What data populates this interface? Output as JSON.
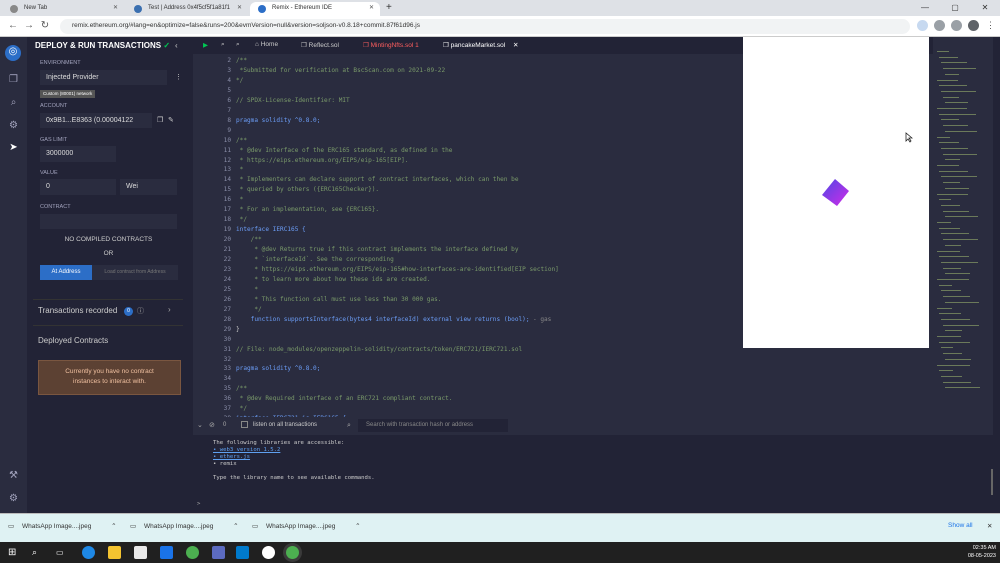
{
  "browser": {
    "tabs": [
      {
        "title": "New Tab"
      },
      {
        "title": "Test | Address 0x4f5cf5f1a81f1"
      },
      {
        "title": "Remix - Ethereum IDE"
      }
    ],
    "new_tab": "+",
    "window_buttons": [
      "—",
      "▢",
      "✕"
    ],
    "url": "remix.ethereum.org/#lang=en&optimize=false&runs=200&evmVersion=null&version=soljson-v0.8.18+commit.87f61d96.js"
  },
  "sidebar": {
    "title": "DEPLOY & RUN TRANSACTIONS",
    "environment_label": "ENVIRONMENT",
    "environment_value": "Injected Provider",
    "network_badge": "Custom (80001) network",
    "account_label": "ACCOUNT",
    "account_value": "0x9B1...E8363 (0.00004122",
    "gas_limit_label": "GAS LIMIT",
    "gas_limit_value": "3000000",
    "value_label": "VALUE",
    "value_amount": "0",
    "value_unit": "Wei",
    "contract_label": "CONTRACT",
    "no_contracts": "NO COMPILED CONTRACTS",
    "or": "OR",
    "at_address": "At Address",
    "load_contract": "Load contract from Address",
    "transactions_recorded": "Transactions recorded",
    "transactions_count": "0",
    "deployed_contracts": "Deployed Contracts",
    "no_instances": "Currently you have no contract instances to interact with."
  },
  "editor": {
    "tabs": [
      {
        "label": "Home"
      },
      {
        "label": "Reflect.sol"
      },
      {
        "label": "MintingNfts.sol",
        "badge": "1"
      },
      {
        "label": "pancakeMarket.sol"
      }
    ],
    "lines": [
      {
        "n": "2",
        "t": "/**"
      },
      {
        "n": "3",
        "t": " *Submitted for verification at BscScan.com on 2021-09-22"
      },
      {
        "n": "4",
        "t": "*/"
      },
      {
        "n": "5",
        "t": ""
      },
      {
        "n": "6",
        "t": "// SPDX-License-Identifier: MIT"
      },
      {
        "n": "7",
        "t": ""
      },
      {
        "n": "8",
        "t": "pragma solidity ^0.8.0;"
      },
      {
        "n": "9",
        "t": ""
      },
      {
        "n": "10",
        "t": "/**"
      },
      {
        "n": "11",
        "t": " * @dev Interface of the ERC165 standard, as defined in the"
      },
      {
        "n": "12",
        "t": " * https://eips.ethereum.org/EIPS/eip-165[EIP]."
      },
      {
        "n": "13",
        "t": " *"
      },
      {
        "n": "14",
        "t": " * Implementers can declare support of contract interfaces, which can then be"
      },
      {
        "n": "15",
        "t": " * queried by others ({ERC165Checker})."
      },
      {
        "n": "16",
        "t": " *"
      },
      {
        "n": "17",
        "t": " * For an implementation, see {ERC165}."
      },
      {
        "n": "18",
        "t": " */"
      },
      {
        "n": "19",
        "t": "interface IERC165 {"
      },
      {
        "n": "20",
        "t": "    /**"
      },
      {
        "n": "21",
        "t": "     * @dev Returns true if this contract implements the interface defined by"
      },
      {
        "n": "22",
        "t": "     * `interfaceId`. See the corresponding"
      },
      {
        "n": "23",
        "t": "     * https://eips.ethereum.org/EIPS/eip-165#how-interfaces-are-identified[EIP section]"
      },
      {
        "n": "24",
        "t": "     * to learn more about how these ids are created."
      },
      {
        "n": "25",
        "t": "     *"
      },
      {
        "n": "26",
        "t": "     * This function call must use less than 30 000 gas."
      },
      {
        "n": "27",
        "t": "     */"
      },
      {
        "n": "28",
        "t": "    function supportsInterface(bytes4 interfaceId) external view returns (bool);"
      },
      {
        "n": "29",
        "t": "}"
      },
      {
        "n": "30",
        "t": ""
      },
      {
        "n": "31",
        "t": "// File: node_modules/openzeppelin-solidity/contracts/token/ERC721/IERC721.sol"
      },
      {
        "n": "32",
        "t": ""
      },
      {
        "n": "33",
        "t": "pragma solidity ^0.8.0;"
      },
      {
        "n": "34",
        "t": ""
      },
      {
        "n": "35",
        "t": "/**"
      },
      {
        "n": "36",
        "t": " * @dev Required interface of an ERC721 compliant contract."
      },
      {
        "n": "37",
        "t": " */"
      },
      {
        "n": "38",
        "t": "interface IERC721 is IERC165 {"
      }
    ],
    "gas_hint": "- gas"
  },
  "terminal": {
    "count": "0",
    "listen_label": "listen on all transactions",
    "search_placeholder": "Search with transaction hash or address",
    "lines": [
      "The following libraries are accessible:",
      "• web3 version 1.5.2",
      "• ethers.js",
      "• remix",
      "",
      "Type the library name to see available commands."
    ],
    "prompt": ">"
  },
  "downloads": {
    "items": [
      "WhatsApp Image....jpeg",
      "WhatsApp Image....jpeg",
      "WhatsApp Image....jpeg"
    ],
    "show_all": "Show all"
  },
  "taskbar": {
    "time": "02:35 AM",
    "date": "08-05-2023"
  },
  "colors": {
    "remix_bg": "#222336",
    "remix_panel": "#2a2c3f",
    "accent_blue": "#2c6ec7",
    "error_red": "#ff5e5e"
  }
}
